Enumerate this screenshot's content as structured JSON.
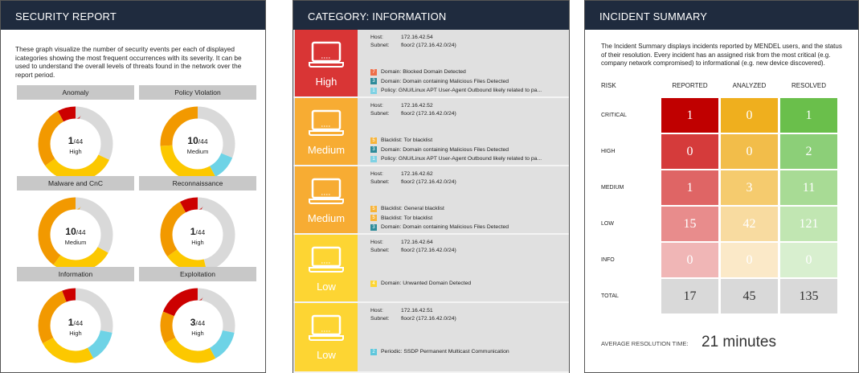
{
  "security_report": {
    "title": "SECURITY REPORT",
    "description": "These graph visualize the number of security events per each of displayed icategories showing the most frequent occurrences with its severity. It can be used to understand the overall levels of threats found in the network over the report period.",
    "colors": {
      "critical": "#cc0000",
      "high": "#f29900",
      "medium": "#fcc800",
      "low": "#6ed3e6",
      "none": "#d9d9d9"
    },
    "categories": [
      {
        "name": "Anomaly",
        "count": "1",
        "total": "/44",
        "severity": "High",
        "segments": [
          {
            "c": "none",
            "v": 32
          },
          {
            "c": "medium",
            "v": 33
          },
          {
            "c": "high",
            "v": 27
          },
          {
            "c": "critical",
            "v": 8
          }
        ]
      },
      {
        "name": "Policy Violation",
        "count": "10",
        "total": "/44",
        "severity": "Medium",
        "segments": [
          {
            "c": "none",
            "v": 31
          },
          {
            "c": "low",
            "v": 11
          },
          {
            "c": "medium",
            "v": 32
          },
          {
            "c": "high",
            "v": 26
          }
        ]
      },
      {
        "name": "Malware and CnC",
        "count": "10",
        "total": "/44",
        "severity": "Medium",
        "segments": [
          {
            "c": "none",
            "v": 33
          },
          {
            "c": "medium",
            "v": 27
          },
          {
            "c": "high",
            "v": 40
          }
        ]
      },
      {
        "name": "Reconnaissance",
        "count": "1",
        "total": "/44",
        "severity": "High",
        "segments": [
          {
            "c": "none",
            "v": 46
          },
          {
            "c": "medium",
            "v": 19
          },
          {
            "c": "high",
            "v": 27
          },
          {
            "c": "critical",
            "v": 8
          }
        ]
      },
      {
        "name": "Information",
        "count": "1",
        "total": "/44",
        "severity": "High",
        "segments": [
          {
            "c": "none",
            "v": 28
          },
          {
            "c": "low",
            "v": 14
          },
          {
            "c": "medium",
            "v": 25
          },
          {
            "c": "high",
            "v": 27
          },
          {
            "c": "critical",
            "v": 6
          }
        ]
      },
      {
        "name": "Exploitation",
        "count": "3",
        "total": "/44",
        "severity": "High",
        "segments": [
          {
            "c": "none",
            "v": 28
          },
          {
            "c": "low",
            "v": 14
          },
          {
            "c": "medium",
            "v": 25
          },
          {
            "c": "high",
            "v": 14
          },
          {
            "c": "critical",
            "v": 19
          }
        ]
      }
    ]
  },
  "category": {
    "title": "CATEGORY:  INFORMATION",
    "host_label": "Host:",
    "subnet_label": "Subnet:",
    "hosts": [
      {
        "severity": "High",
        "color": "#d93535",
        "host": "172.16.42.54",
        "subnet": "floor2 (172.16.42.0/24)",
        "events": [
          {
            "n": "7",
            "color": "#ee6f4a",
            "text": "Domain: Blocked Domain Detected"
          },
          {
            "n": "3",
            "color": "#2e8b9a",
            "text": "Domain: Domain containing Malicious Files Detected"
          },
          {
            "n": "1",
            "color": "#7fd2e4",
            "text": "Policy: GNU/Linux APT User-Agent Outbound likely related to pa..."
          }
        ]
      },
      {
        "severity": "Medium",
        "color": "#f7ac33",
        "host": "172.16.42.52",
        "subnet": "floor2 (172.16.42.0/24)",
        "events": [
          {
            "n": "5",
            "color": "#f7b43a",
            "text": "Blacklist: Tor blacklist"
          },
          {
            "n": "3",
            "color": "#2e8b9a",
            "text": "Domain: Domain containing Malicious Files Detected"
          },
          {
            "n": "1",
            "color": "#7fd2e4",
            "text": "Policy: GNU/Linux APT User-Agent Outbound likely related to pa..."
          }
        ]
      },
      {
        "severity": "Medium",
        "color": "#f7ac33",
        "host": "172.16.42.62",
        "subnet": "floor2 (172.16.42.0/24)",
        "events": [
          {
            "n": "5",
            "color": "#f7b43a",
            "text": "Blacklist: General blacklist"
          },
          {
            "n": "5",
            "color": "#f7b43a",
            "text": "Blacklist: Tor blacklist"
          },
          {
            "n": "3",
            "color": "#2e8b9a",
            "text": "Domain: Domain containing Malicious Files Detected"
          }
        ]
      },
      {
        "severity": "Low",
        "color": "#fdd533",
        "host": "172.16.42.64",
        "subnet": "floor2 (172.16.42.0/24)",
        "events": [
          {
            "n": "4",
            "color": "#fdd533",
            "text": "Domain: Unwanted Domain Detected"
          }
        ]
      },
      {
        "severity": "Low",
        "color": "#fdd533",
        "host": "172.16.42.51",
        "subnet": "floor2 (172.16.42.0/24)",
        "events": [
          {
            "n": "2",
            "color": "#5fc7dc",
            "text": "Periodic: SSDP Permanent Multicast Communication"
          }
        ]
      }
    ]
  },
  "incident_summary": {
    "title": "INCIDENT SUMMARY",
    "description": "The Incident Summary displays incidents reported by MENDEL users, and the status of their resolution. Every incident has an assigned risk from the most critical (e.g. company network compromised) to informational (e.g. new device discovered).",
    "columns": [
      "RISK",
      "REPORTED",
      "ANALYZED",
      "RESOLVED"
    ],
    "rows": [
      {
        "risk": "CRITICAL",
        "values": [
          "1",
          "0",
          "1"
        ],
        "colors": [
          "#c00000",
          "#efaf1e",
          "#6abf4b"
        ]
      },
      {
        "risk": "HIGH",
        "values": [
          "0",
          "0",
          "2"
        ],
        "colors": [
          "#d53b3b",
          "#f2bd4a",
          "#8ccf78"
        ]
      },
      {
        "risk": "MEDIUM",
        "values": [
          "1",
          "3",
          "11"
        ],
        "colors": [
          "#df6565",
          "#f5cb6e",
          "#a8db95"
        ]
      },
      {
        "risk": "LOW",
        "values": [
          "15",
          "42",
          "121"
        ],
        "colors": [
          "#e88c8c",
          "#f8dba0",
          "#c1e6b2"
        ]
      },
      {
        "risk": "INFO",
        "values": [
          "0",
          "0",
          "0"
        ],
        "colors": [
          "#f0b6b6",
          "#fbe9c8",
          "#d8efcf"
        ]
      },
      {
        "risk": "TOTAL",
        "values": [
          "17",
          "45",
          "135"
        ],
        "colors": [
          "#d9d9d9",
          "#d9d9d9",
          "#d9d9d9"
        ]
      }
    ],
    "avg_label": "AVERAGE RESOLUTION TIME:",
    "avg_value": "21 minutes"
  }
}
